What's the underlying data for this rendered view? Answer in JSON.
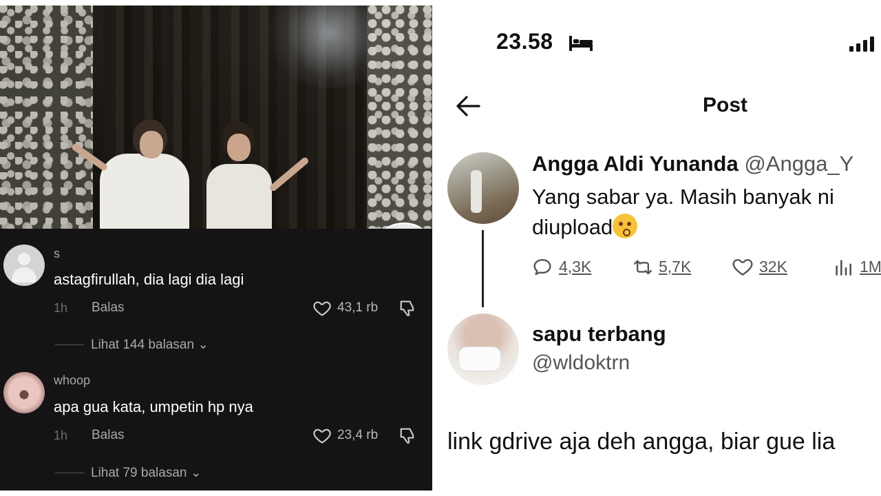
{
  "left_panel": {
    "comments": [
      {
        "username": "s",
        "text": "astagfirullah, dia lagi dia lagi",
        "time": "1h",
        "reply_label": "Balas",
        "likes": "43,1 rb",
        "view_replies": "Lihat 144 balasan ⌄"
      },
      {
        "username": "whoop",
        "text": "apa gua kata, umpetin hp nya",
        "time": "1h",
        "reply_label": "Balas",
        "likes": "23,4 rb",
        "view_replies": "Lihat 79 balasan ⌄"
      }
    ]
  },
  "right_panel": {
    "status_time": "23.58",
    "header_title": "Post",
    "tweet": {
      "author_name": "Angga Aldi Yunanda",
      "author_handle": "@Angga_Y",
      "text_line1": "Yang sabar ya. Masih banyak ni",
      "text_line2": "diupload",
      "replies": "4,3K",
      "retweets": "5,7K",
      "likes": "32K",
      "views": "1M"
    },
    "reply": {
      "author_name": "sapu terbang",
      "author_handle": "@wldoktrn",
      "text": "link gdrive aja deh angga, biar gue lia"
    }
  }
}
